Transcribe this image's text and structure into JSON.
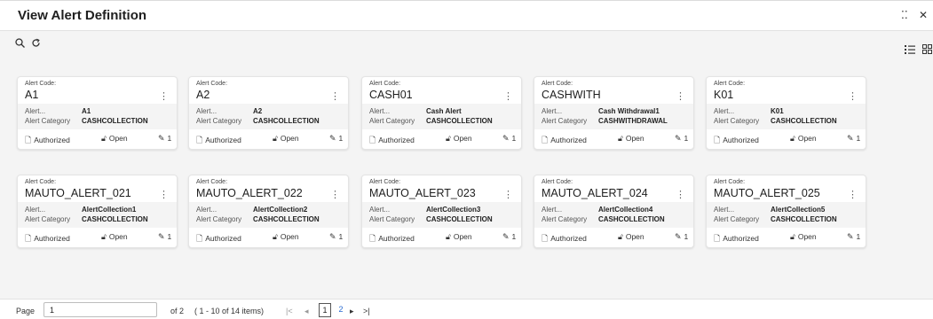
{
  "header": {
    "title": "View Alert Definition",
    "minimize_icon": "collapse-icon",
    "close_icon": "close-icon"
  },
  "toolbar": {
    "search_icon": "search-icon",
    "refresh_icon": "refresh-icon",
    "list_view_icon": "list-view-icon",
    "grid_view_icon": "grid-view-icon"
  },
  "card_labels": {
    "code_label": "Alert Code:",
    "alert_label": "Alert...",
    "category_label": "Alert Category"
  },
  "cards": [
    {
      "code": "A1",
      "alert": "A1",
      "category": "CASHCOLLECTION",
      "status": "Authorized",
      "lock": "Open",
      "version": "1"
    },
    {
      "code": "A2",
      "alert": "A2",
      "category": "CASHCOLLECTION",
      "status": "Authorized",
      "lock": "Open",
      "version": "1"
    },
    {
      "code": "CASH01",
      "alert": "Cash Alert",
      "category": "CASHCOLLECTION",
      "status": "Authorized",
      "lock": "Open",
      "version": "1"
    },
    {
      "code": "CASHWITH",
      "alert": "Cash Withdrawal1",
      "category": "CASHWITHDRAWAL",
      "status": "Authorized",
      "lock": "Open",
      "version": "1"
    },
    {
      "code": "K01",
      "alert": "K01",
      "category": "CASHCOLLECTION",
      "status": "Authorized",
      "lock": "Open",
      "version": "1"
    },
    {
      "code": "MAUTO_ALERT_021",
      "alert": "AlertCollection1",
      "category": "CASHCOLLECTION",
      "status": "Authorized",
      "lock": "Open",
      "version": "1"
    },
    {
      "code": "MAUTO_ALERT_022",
      "alert": "AlertCollection2",
      "category": "CASHCOLLECTION",
      "status": "Authorized",
      "lock": "Open",
      "version": "1"
    },
    {
      "code": "MAUTO_ALERT_023",
      "alert": "AlertCollection3",
      "category": "CASHCOLLECTION",
      "status": "Authorized",
      "lock": "Open",
      "version": "1"
    },
    {
      "code": "MAUTO_ALERT_024",
      "alert": "AlertCollection4",
      "category": "CASHCOLLECTION",
      "status": "Authorized",
      "lock": "Open",
      "version": "1"
    },
    {
      "code": "MAUTO_ALERT_025",
      "alert": "AlertCollection5",
      "category": "CASHCOLLECTION",
      "status": "Authorized",
      "lock": "Open",
      "version": "1"
    }
  ],
  "pagination": {
    "page_label": "Page",
    "page_value": "1",
    "of_label": "of 2",
    "items_info": "( 1 - 10 of 14 items)",
    "first_icon": "first-page-icon",
    "prev_icon": "prev-page-icon",
    "next_icon": "next-page-icon",
    "last_icon": "last-page-icon",
    "pages": [
      "1",
      "2"
    ]
  }
}
